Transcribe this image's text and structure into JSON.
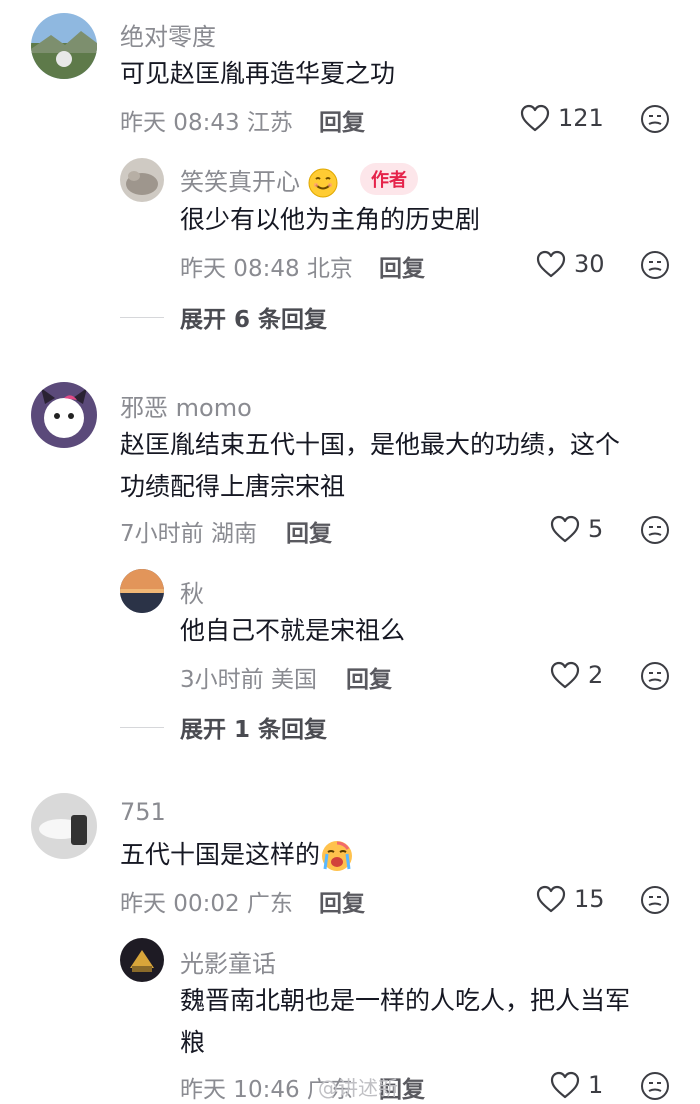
{
  "comments": [
    {
      "username": "绝对零度",
      "text": "可见赵匡胤再造华夏之功",
      "time": "昨天 08:43",
      "location": "江苏",
      "reply_label": "回复",
      "likes": "121",
      "replies": [
        {
          "username": "笑笑真开心",
          "badge": "作者",
          "text": "很少有以他为主角的历史剧",
          "time": "昨天 08:48",
          "location": "北京",
          "reply_label": "回复",
          "likes": "30"
        }
      ],
      "expand_label": "展开 6 条回复"
    },
    {
      "username": "邪恶 momo",
      "text_line1": "赵匡胤结束五代十国，是他最大的功绩，这个",
      "text_line2": "功绩配得上唐宗宋祖",
      "time": "7小时前",
      "location": "湖南",
      "reply_label": "回复",
      "likes": "5",
      "replies": [
        {
          "username": "秋",
          "text": "他自己不就是宋祖么",
          "time": "3小时前",
          "location": "美国",
          "reply_label": "回复",
          "likes": "2"
        }
      ],
      "expand_label": "展开 1 条回复"
    },
    {
      "username": "751",
      "text": "五代十国是这样的",
      "time": "昨天 00:02",
      "location": "广东",
      "reply_label": "回复",
      "likes": "15",
      "replies": [
        {
          "username": "光影童话",
          "text_line1": "魏晋南北朝也是一样的人吃人，把人当军",
          "text_line2": "粮",
          "time": "昨天 10:46",
          "location": "广东",
          "reply_label": "回复",
          "likes": "1"
        }
      ]
    }
  ],
  "watermark": "@讲述新"
}
